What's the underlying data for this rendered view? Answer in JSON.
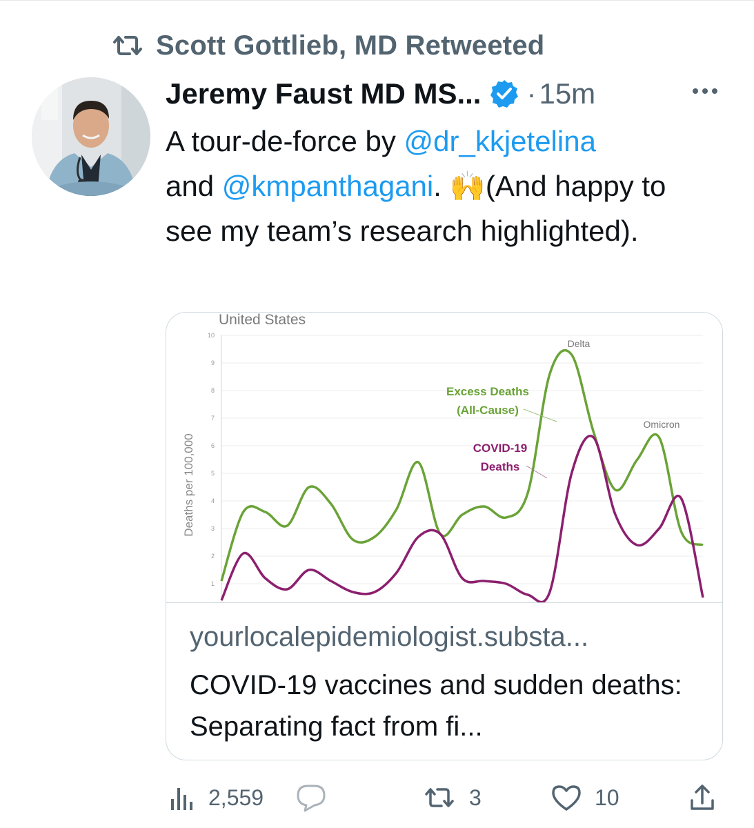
{
  "retweet_context": {
    "label": "Scott Gottlieb, MD Retweeted",
    "icon": "retweet-icon"
  },
  "tweet": {
    "author_name": "Jeremy Faust MD MS...",
    "verified_color": "#1d9bf0",
    "dot": "·",
    "timestamp": "15m",
    "more_icon": "more-icon",
    "text": {
      "part1": "A tour-de-force by ",
      "mention1": "@dr_kkjetelina",
      "part2": "and ",
      "mention2": "@kmpanthagani",
      "part3": ". ",
      "emoji": "🙌",
      "part4": "(And happy to see my team’s research highlighted)."
    }
  },
  "card": {
    "domain": "yourlocalepidemiologist.substa...",
    "title": "COVID-19 vaccines and sudden deaths: Separating fact from fi..."
  },
  "chart_data": {
    "type": "line",
    "title": "United States",
    "ylabel": "Deaths per 100,000",
    "xlabel": "",
    "ylim": [
      0,
      10
    ],
    "yticks": [
      1,
      2,
      3,
      4,
      5,
      6,
      7,
      8,
      9,
      10
    ],
    "series": [
      {
        "name": "Excess Deaths (All-Cause)",
        "color": "#6aa337",
        "values": [
          1.1,
          3.6,
          3.6,
          3.1,
          4.5,
          3.9,
          2.6,
          2.7,
          3.7,
          5.4,
          2.8,
          3.5,
          3.8,
          3.4,
          4.3,
          8.6,
          9.3,
          6.5,
          4.4,
          5.5,
          6.3,
          2.9,
          2.4
        ]
      },
      {
        "name": "COVID-19 Deaths",
        "color": "#8c1f6e",
        "values": [
          0.4,
          2.1,
          1.2,
          0.8,
          1.5,
          1.1,
          0.7,
          0.7,
          1.4,
          2.7,
          2.8,
          1.2,
          1.1,
          1.0,
          0.6,
          0.7,
          5.0,
          6.3,
          3.5,
          2.4,
          3.0,
          4.1,
          0.5
        ]
      }
    ],
    "annotations": [
      {
        "text": "Delta"
      },
      {
        "text": "Omicron"
      },
      {
        "text_line1": "Excess Deaths",
        "text_line2": "(All-Cause)"
      },
      {
        "text_line1": "COVID-19",
        "text_line2": "Deaths"
      }
    ],
    "grid": true,
    "legend": "inline annotations"
  },
  "actions": {
    "views": {
      "count": "2,559",
      "icon": "analytics-icon"
    },
    "reply": {
      "count": "",
      "icon": "reply-icon"
    },
    "retweets": {
      "count": "3",
      "icon": "retweet-icon"
    },
    "likes": {
      "count": "10",
      "icon": "heart-icon"
    },
    "share": {
      "icon": "share-icon"
    }
  }
}
